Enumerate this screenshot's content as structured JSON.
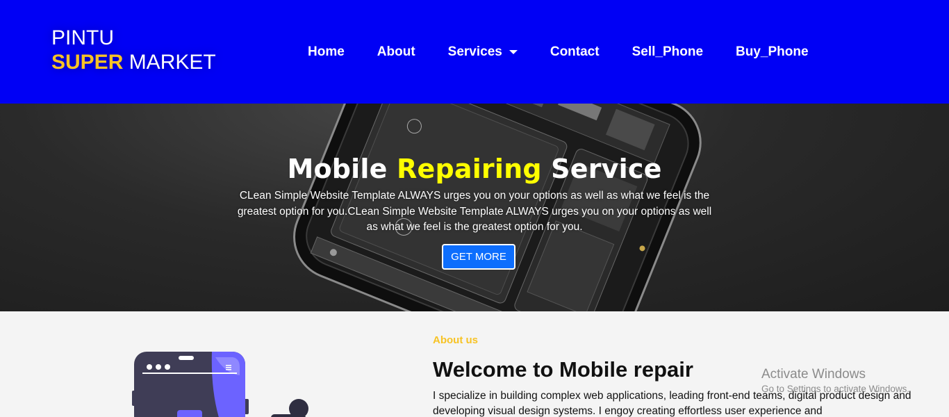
{
  "brand": {
    "line1": "PINTU",
    "accent": "SUPER",
    "rest": " MARKET"
  },
  "nav": {
    "items": [
      {
        "label": "Home"
      },
      {
        "label": "About"
      },
      {
        "label": "Services"
      },
      {
        "label": "Contact"
      },
      {
        "label": "Sell_Phone"
      },
      {
        "label": "Buy_Phone"
      }
    ]
  },
  "hero": {
    "title_start": "Mobile ",
    "title_highlight": "Repairing",
    "title_end": " Service",
    "text": "CLean Simple Website Template ALWAYS urges you on your options as well as what we feel is the greatest option for you.CLean Simple Website Template ALWAYS urges you on your options as well as what we feel is the greatest option for you.",
    "button": "GET MORE"
  },
  "about": {
    "label": "About us",
    "title": "Welcome to Mobile repair",
    "text": "I specialize in building complex web applications, leading front-end teams, digital product design and developing visual design systems. I engoy creating effortless user experience and"
  },
  "watermark": {
    "title": "Activate Windows",
    "subtitle": "Go to Settings to activate Windows."
  },
  "colors": {
    "navbar": "#0000f5",
    "accent_yellow": "#f7c325",
    "hero_highlight": "#ffff00",
    "button_blue": "#0d6efd",
    "illustration_purple": "#6c63ff",
    "illustration_dark": "#3f3d56"
  }
}
